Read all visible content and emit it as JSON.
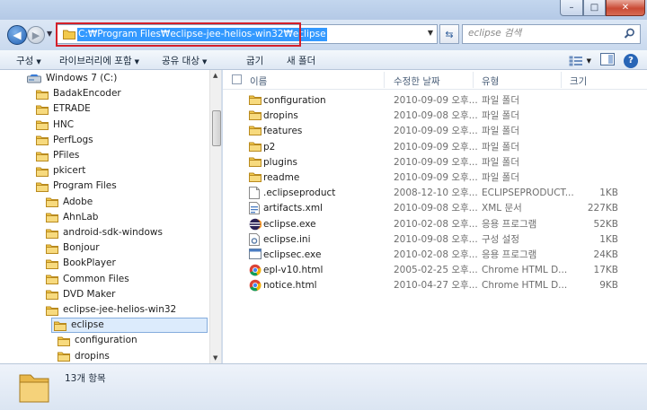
{
  "window": {
    "min_glyph": "–",
    "max_glyph": "□",
    "close_glyph": "✕"
  },
  "address": {
    "path": "C:\\Program Files\\eclipse-jee-helios-win32\\eclipse",
    "path_display": "C:₩Program Files₩eclipse-jee-helios-win32₩eclipse"
  },
  "search": {
    "placeholder": "eclipse 검색"
  },
  "nav_glyphs": {
    "back": "◀",
    "forward": "▶",
    "history": "▼",
    "refresh": "⇆"
  },
  "toolbar": {
    "organize": "구성",
    "include_in_library": "라이브러리에 포함",
    "share_with": "공유 대상",
    "burn": "굽기",
    "new_folder": "새 폴더",
    "dropdown_glyph": "▼",
    "help_glyph": "?"
  },
  "tree": [
    {
      "label": "Windows 7 (C:)",
      "icon": "drive-icon",
      "indent": 0
    },
    {
      "label": "BadakEncoder",
      "icon": "folder-icon",
      "indent": 1
    },
    {
      "label": "ETRADE",
      "icon": "folder-icon",
      "indent": 1
    },
    {
      "label": "HNC",
      "icon": "folder-icon",
      "indent": 1
    },
    {
      "label": "PerfLogs",
      "icon": "folder-icon",
      "indent": 1
    },
    {
      "label": "PFiles",
      "icon": "folder-icon",
      "indent": 1
    },
    {
      "label": "pkicert",
      "icon": "folder-icon",
      "indent": 1
    },
    {
      "label": "Program Files",
      "icon": "folder-icon",
      "indent": 1
    },
    {
      "label": "Adobe",
      "icon": "folder-icon",
      "indent": 2
    },
    {
      "label": "AhnLab",
      "icon": "folder-icon",
      "indent": 2
    },
    {
      "label": "android-sdk-windows",
      "icon": "folder-icon",
      "indent": 2
    },
    {
      "label": "Bonjour",
      "icon": "folder-icon",
      "indent": 2
    },
    {
      "label": "BookPlayer",
      "icon": "folder-icon",
      "indent": 2
    },
    {
      "label": "Common Files",
      "icon": "folder-icon",
      "indent": 2
    },
    {
      "label": "DVD Maker",
      "icon": "folder-icon",
      "indent": 2
    },
    {
      "label": "eclipse-jee-helios-win32",
      "icon": "folder-icon",
      "indent": 2
    },
    {
      "label": "eclipse",
      "icon": "folder-icon",
      "indent": 3,
      "selected": true
    },
    {
      "label": "configuration",
      "icon": "folder-icon",
      "indent": 4
    },
    {
      "label": "dropins",
      "icon": "folder-icon",
      "indent": 4
    }
  ],
  "columns": {
    "name": "이름",
    "date": "수정한 날짜",
    "type": "유형",
    "size": "크기"
  },
  "files": [
    {
      "name": "configuration",
      "date": "2010-09-09 오후...",
      "type": "파일 폴더",
      "size": "",
      "icon": "folder-icon"
    },
    {
      "name": "dropins",
      "date": "2010-09-08 오후...",
      "type": "파일 폴더",
      "size": "",
      "icon": "folder-icon"
    },
    {
      "name": "features",
      "date": "2010-09-09 오후...",
      "type": "파일 폴더",
      "size": "",
      "icon": "folder-icon"
    },
    {
      "name": "p2",
      "date": "2010-09-09 오후...",
      "type": "파일 폴더",
      "size": "",
      "icon": "folder-icon"
    },
    {
      "name": "plugins",
      "date": "2010-09-09 오후...",
      "type": "파일 폴더",
      "size": "",
      "icon": "folder-icon"
    },
    {
      "name": "readme",
      "date": "2010-09-09 오후...",
      "type": "파일 폴더",
      "size": "",
      "icon": "folder-icon"
    },
    {
      "name": ".eclipseproduct",
      "date": "2008-12-10 오후...",
      "type": "ECLIPSEPRODUCT...",
      "size": "1KB",
      "icon": "file-icon"
    },
    {
      "name": "artifacts.xml",
      "date": "2010-09-08 오후...",
      "type": "XML 문서",
      "size": "227KB",
      "icon": "xml-file-icon"
    },
    {
      "name": "eclipse.exe",
      "date": "2010-02-08 오후...",
      "type": "응용 프로그램",
      "size": "52KB",
      "icon": "eclipse-app-icon"
    },
    {
      "name": "eclipse.ini",
      "date": "2010-09-08 오후...",
      "type": "구성 설정",
      "size": "1KB",
      "icon": "ini-file-icon"
    },
    {
      "name": "eclipsec.exe",
      "date": "2010-02-08 오후...",
      "type": "응용 프로그램",
      "size": "24KB",
      "icon": "exe-file-icon"
    },
    {
      "name": "epl-v10.html",
      "date": "2005-02-25 오후...",
      "type": "Chrome HTML D...",
      "size": "17KB",
      "icon": "chrome-html-icon"
    },
    {
      "name": "notice.html",
      "date": "2010-04-27 오후...",
      "type": "Chrome HTML D...",
      "size": "9KB",
      "icon": "chrome-html-icon"
    }
  ],
  "status": {
    "item_count": "13개 항목"
  },
  "colors": {
    "selection_blue": "#3399ff",
    "highlight_red": "#d4202a",
    "folder_yellow": "#f2c94c"
  }
}
